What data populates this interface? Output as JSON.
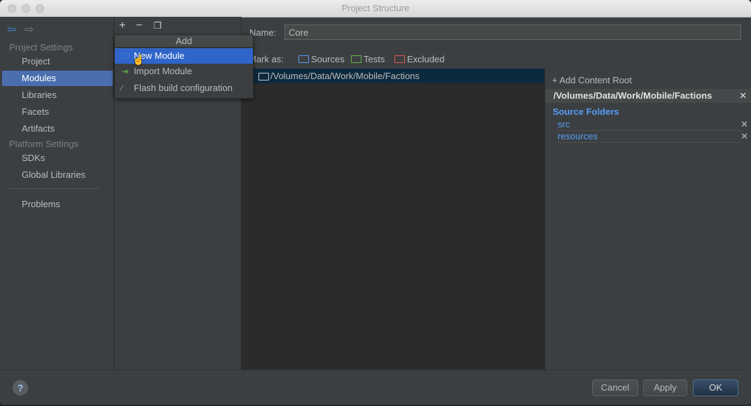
{
  "window": {
    "title": "Project Structure"
  },
  "sidebar": {
    "project_settings_header": "Project Settings",
    "items": [
      "Project",
      "Modules",
      "Libraries",
      "Facets",
      "Artifacts"
    ],
    "platform_settings_header": "Platform Settings",
    "platform_items": [
      "SDKs",
      "Global Libraries"
    ],
    "problems": "Problems",
    "selected": "Modules"
  },
  "toolbar": {
    "add_icon": "plus-icon",
    "remove_icon": "minus-icon",
    "copy_icon": "copy-icon"
  },
  "popup": {
    "header": "Add",
    "items": [
      {
        "label": "New Module",
        "icon": "module-folder-icon",
        "selected": true
      },
      {
        "label": "Import Module",
        "icon": "import-module-icon"
      },
      {
        "label": "Flash build configuration",
        "icon": "flash-icon"
      }
    ]
  },
  "main": {
    "name_label": "Name:",
    "name_value": "Core",
    "mark_as_label": "Mark as:",
    "mark_sources": "Sources",
    "mark_tests": "Tests",
    "mark_excluded": "Excluded",
    "tree_path": "/Volumes/Data/Work/Mobile/Factions"
  },
  "right_panel": {
    "add_content_root": "Add Content Root",
    "root_path": "/Volumes/Data/Work/Mobile/Factions",
    "source_folders_title": "Source Folders",
    "source_folders": [
      "src",
      "resources"
    ]
  },
  "buttons": {
    "cancel": "Cancel",
    "apply": "Apply",
    "ok": "OK",
    "help": "?"
  },
  "colors": {
    "selection": "#4b6eaf",
    "popup_selection": "#2f65ca",
    "source_blue": "#589df6",
    "tests_green": "#62b543",
    "excluded_red": "#e05555"
  }
}
